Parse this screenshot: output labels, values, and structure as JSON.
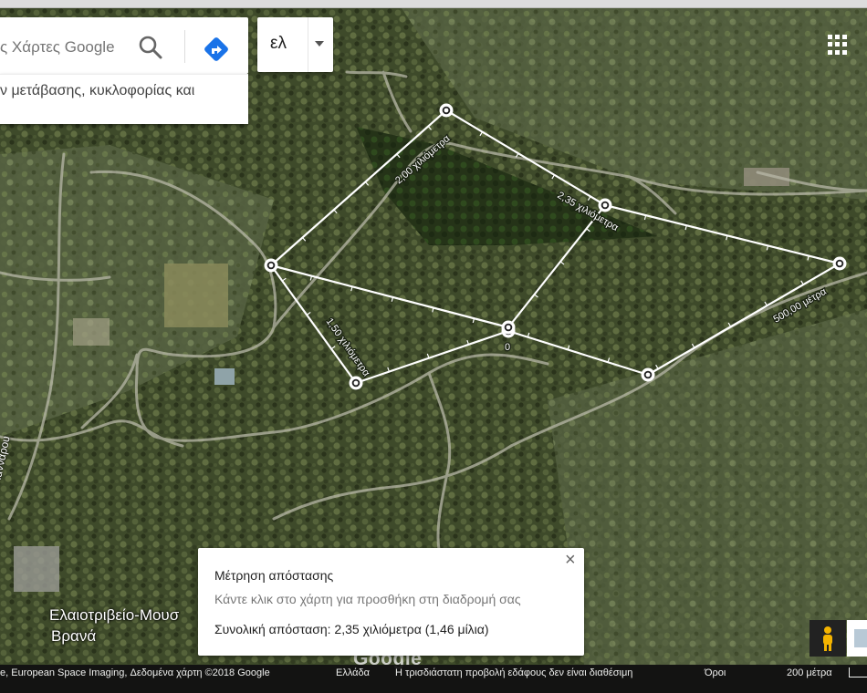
{
  "search": {
    "placeholder": "ς Χάρτες Google"
  },
  "search_hint": "ν μετάβασης, κυκλοφορίας και",
  "language_button": "ελ",
  "map_labels": {
    "place_name_1": "Ελαιοτριβείο-Μουσ",
    "place_name_2": "Βρανά",
    "street_name": "Φαρμακολκτουλου-Γιαννάρου",
    "google_logo": "Google"
  },
  "measure": {
    "labels": [
      {
        "text": "2,00 χιλιόμετρα"
      },
      {
        "text": "2,35 χιλιόμετρα"
      },
      {
        "text": "500,00 μέτρα"
      },
      {
        "text": "1,50 χιλιόμετρα"
      },
      {
        "text": "0"
      }
    ]
  },
  "distance_card": {
    "title": "Μέτρηση απόστασης",
    "hint": "Κάντε κλικ στο χάρτη για προσθήκη στη διαδρομή σας",
    "total": "Συνολική απόσταση: 2,35 χιλιόμετρα (1,46 μίλια)",
    "close": "×"
  },
  "footer": {
    "attribution": "e, European Space Imaging, Δεδομένα χάρτη ©2018 Google",
    "country": "Ελλάδα",
    "terrain_msg": "Η τρισδιάστατη προβολή εδάφους δεν είναι διαθέσιμη",
    "terms": "Όροι",
    "scale": "200 μέτρα"
  },
  "icons": [
    "search-icon",
    "directions-icon",
    "caret-down-icon",
    "apps-grid-icon",
    "close-icon",
    "pegman-icon",
    "imagery-thumbnail"
  ],
  "colors": {
    "directions_blue": "#1a73e8",
    "pegman": "#f4b400",
    "measure_line": "#ffffff"
  }
}
